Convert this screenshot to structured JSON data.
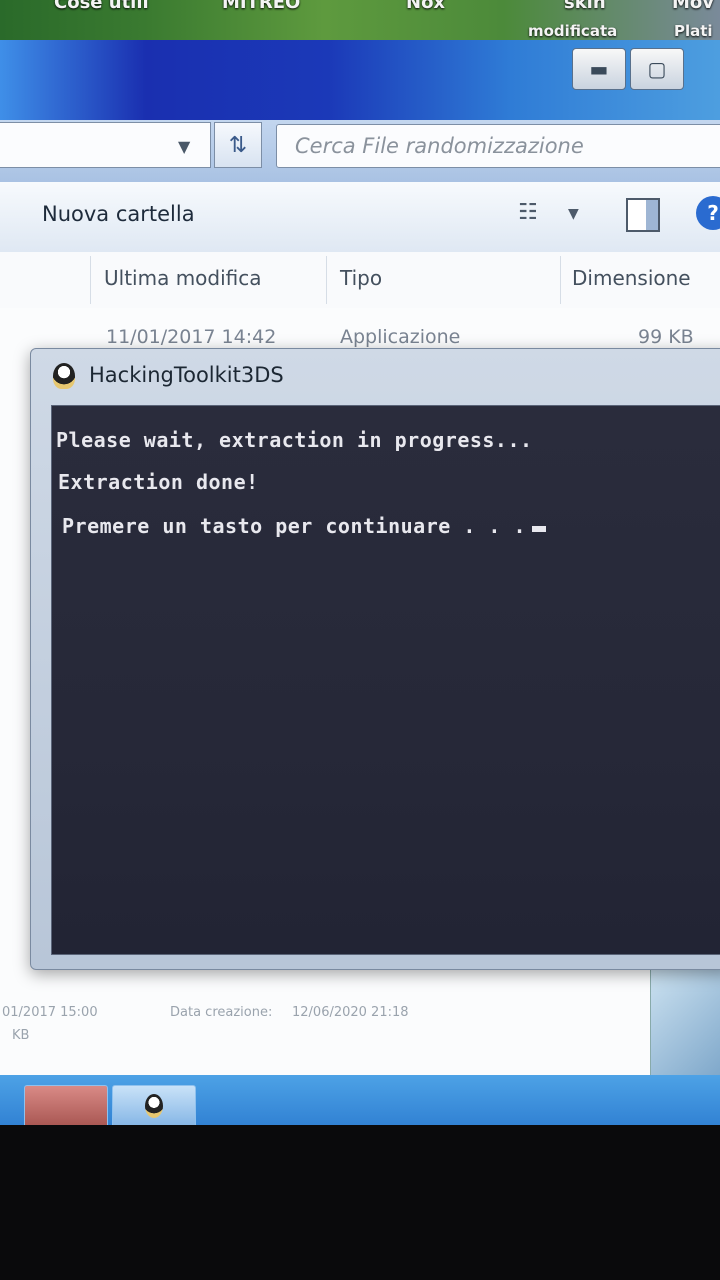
{
  "desktop": {
    "icons": [
      {
        "label": "Cose utili"
      },
      {
        "label": "MITREO"
      },
      {
        "label": "Nox"
      },
      {
        "label": "skin",
        "sub": "modificata"
      },
      {
        "label": "Mov",
        "sub": "Plati"
      }
    ]
  },
  "explorer": {
    "window_buttons": {
      "minimize": "▬",
      "maximize": "▢"
    },
    "search": {
      "placeholder": "Cerca File randomizzazione"
    },
    "toolbar": {
      "new_folder": "Nuova cartella",
      "help": "?"
    },
    "columns": [
      "Ultima modifica",
      "Tipo",
      "Dimensione"
    ],
    "rows": [
      {
        "modified": "11/01/2017 14:42",
        "type": "Applicazione",
        "size": "99 KB"
      }
    ],
    "status": {
      "left_date": "01/2017 15:00",
      "left_size": "KB",
      "right_label": "Data creazione:",
      "right_date": "12/06/2020 21:18"
    }
  },
  "console": {
    "title": "HackingToolkit3DS",
    "lines": [
      "Please wait, extraction in progress...",
      "Extraction done!",
      "Premere un tasto per continuare . . ."
    ]
  },
  "colors": {
    "console_bg": "#262838",
    "console_text": "#e8e8ee",
    "titlebar": "#1b39b8",
    "taskbar": "#3a8fdc"
  }
}
